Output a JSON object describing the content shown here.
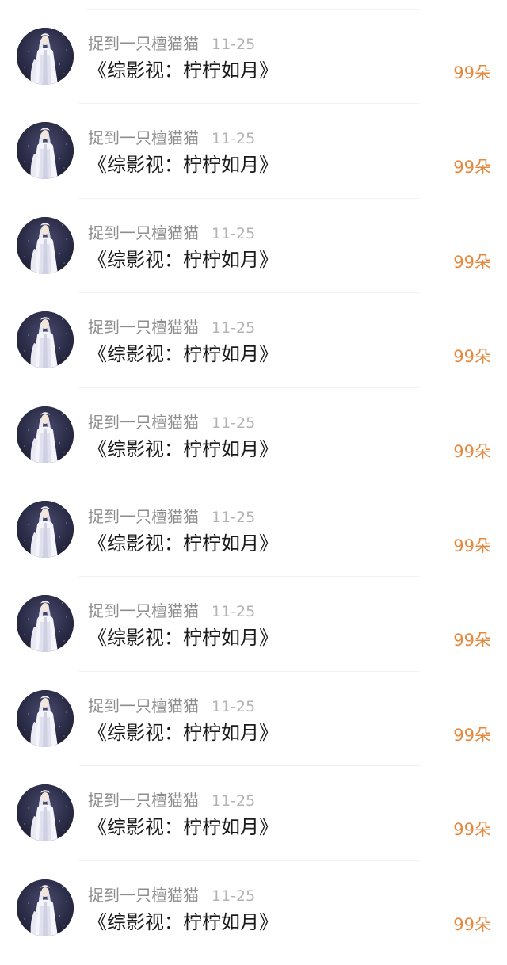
{
  "items": [
    {
      "username": "捉到一只檀猫猫",
      "date": "11-25",
      "title": "《综影视：柠柠如月》",
      "count": "99朵",
      "avatar_icon": "avatar-icon"
    },
    {
      "username": "捉到一只檀猫猫",
      "date": "11-25",
      "title": "《综影视：柠柠如月》",
      "count": "99朵",
      "avatar_icon": "avatar-icon"
    },
    {
      "username": "捉到一只檀猫猫",
      "date": "11-25",
      "title": "《综影视：柠柠如月》",
      "count": "99朵",
      "avatar_icon": "avatar-icon"
    },
    {
      "username": "捉到一只檀猫猫",
      "date": "11-25",
      "title": "《综影视：柠柠如月》",
      "count": "99朵",
      "avatar_icon": "avatar-icon"
    },
    {
      "username": "捉到一只檀猫猫",
      "date": "11-25",
      "title": "《综影视：柠柠如月》",
      "count": "99朵",
      "avatar_icon": "avatar-icon"
    },
    {
      "username": "捉到一只檀猫猫",
      "date": "11-25",
      "title": "《综影视：柠柠如月》",
      "count": "99朵",
      "avatar_icon": "avatar-icon"
    },
    {
      "username": "捉到一只檀猫猫",
      "date": "11-25",
      "title": "《综影视：柠柠如月》",
      "count": "99朵",
      "avatar_icon": "avatar-icon"
    },
    {
      "username": "捉到一只檀猫猫",
      "date": "11-25",
      "title": "《综影视：柠柠如月》",
      "count": "99朵",
      "avatar_icon": "avatar-icon"
    },
    {
      "username": "捉到一只檀猫猫",
      "date": "11-25",
      "title": "《综影视：柠柠如月》",
      "count": "99朵",
      "avatar_icon": "avatar-icon"
    },
    {
      "username": "捉到一只檀猫猫",
      "date": "11-25",
      "title": "《综影视：柠柠如月》",
      "count": "99朵",
      "avatar_icon": "avatar-icon"
    }
  ],
  "colors": {
    "username": "#8e8e8e",
    "date": "#b3b3b3",
    "title": "#1a1a1a",
    "count": "#e5893f",
    "divider": "#f1f1f1"
  }
}
